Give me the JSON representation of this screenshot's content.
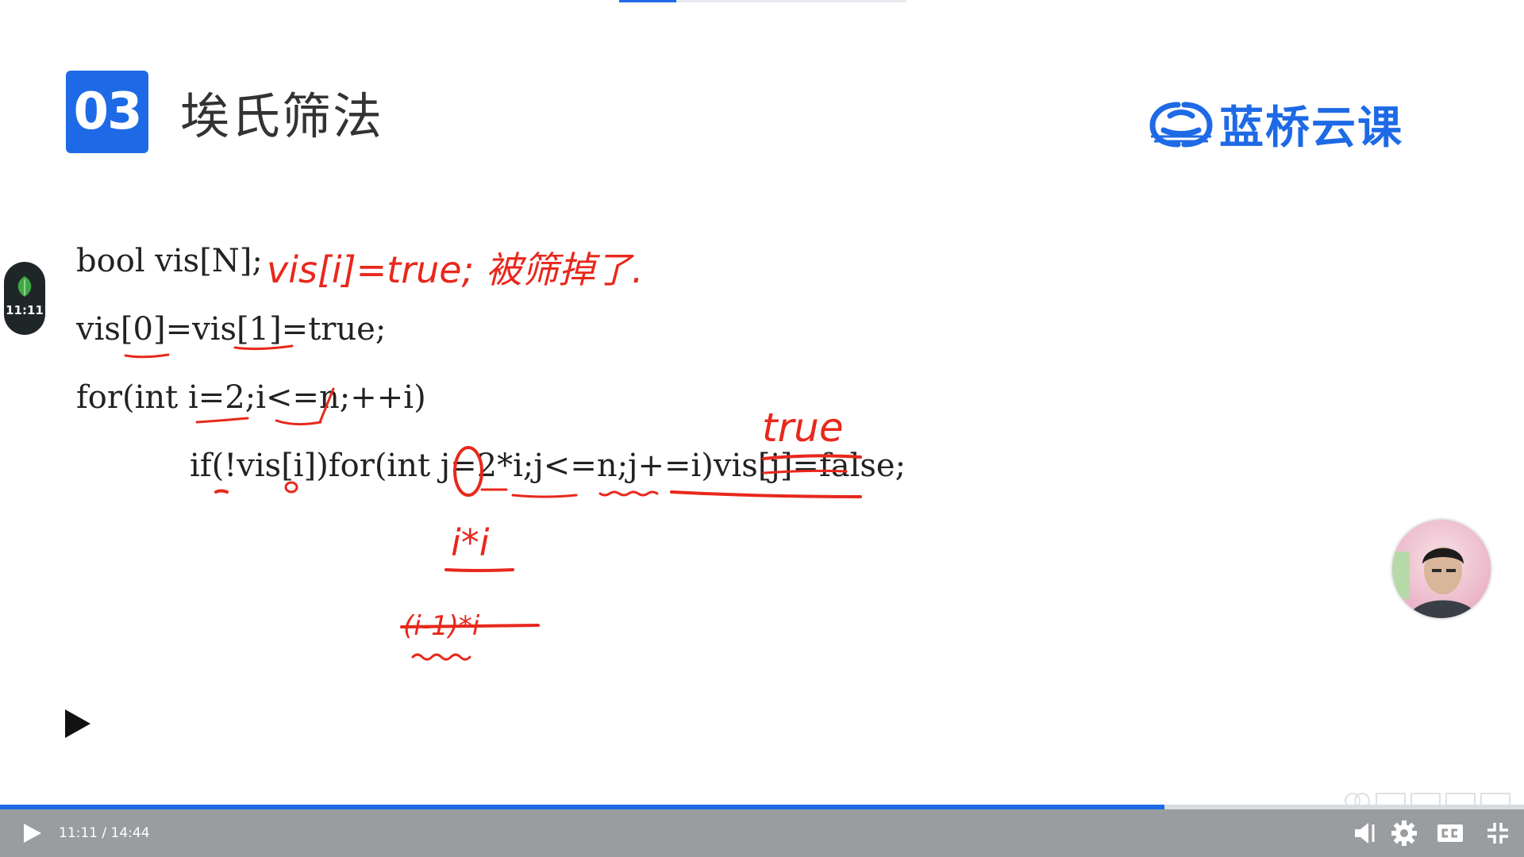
{
  "slide": {
    "number": "03",
    "title": "埃氏筛法",
    "brand": "蓝桥云课"
  },
  "code": [
    "bool vis[N];",
    "vis[0]=vis[1]=true;",
    "for(int i=2;i<=n;++i)",
    "if(!vis[i])for(int j=2*i;j<=n;j+=i)vis[j]=false;"
  ],
  "annotations": {
    "note": "vis[i]=true; 被筛掉了.",
    "replacement": "true",
    "start_hint": "i*i",
    "crossed_hint": "(i-1)*i"
  },
  "timer": {
    "label": "11:11",
    "icon": "leaf-icon"
  },
  "player": {
    "time": "11:11 / 14:44",
    "progress": 0.764,
    "accent": "#1e6ae6",
    "bar_color": "#9a9da0"
  },
  "icons": [
    "play-icon",
    "volume-icon",
    "gear-icon",
    "captions-icon",
    "exit-fullscreen-icon"
  ]
}
